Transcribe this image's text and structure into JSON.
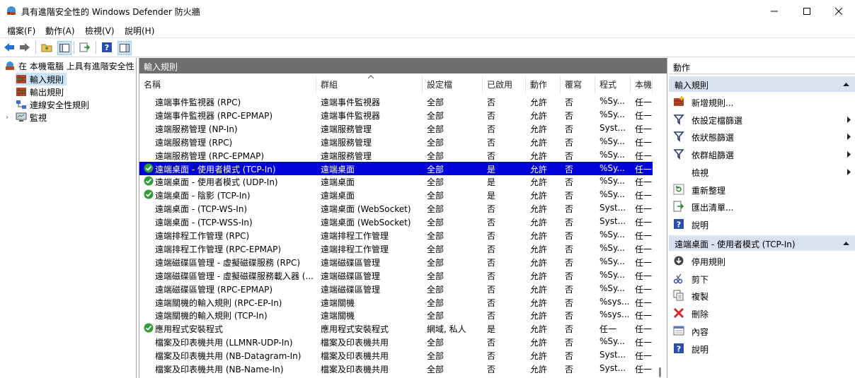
{
  "window": {
    "title": "具有進階安全性的 Windows Defender 防火牆"
  },
  "menu": [
    "檔案(F)",
    "動作(A)",
    "檢視(V)",
    "說明(H)"
  ],
  "tree": {
    "root": "在 本機電腦 上具有進階安全性",
    "items": [
      "輸入規則",
      "輸出規則",
      "連線安全性規則",
      "監視"
    ]
  },
  "center": {
    "title": "輸入規則",
    "columns": [
      "名稱",
      "群組",
      "設定檔",
      "已啟用",
      "動作",
      "覆寫",
      "程式",
      "本機..."
    ],
    "rows": [
      {
        "enabled_icon": false,
        "name": "遠端事件監視器 (RPC)",
        "group": "遠端事件監視器",
        "profile": "全部",
        "enabled": "否",
        "action": "允許",
        "override": "否",
        "program": "%Sy...",
        "local": "任一"
      },
      {
        "enabled_icon": false,
        "name": "遠端事件監視器 (RPC-EPMAP)",
        "group": "遠端事件監視器",
        "profile": "全部",
        "enabled": "否",
        "action": "允許",
        "override": "否",
        "program": "%Sy...",
        "local": "任一"
      },
      {
        "enabled_icon": false,
        "name": "遠端服務管理 (NP-In)",
        "group": "遠端服務管理",
        "profile": "全部",
        "enabled": "否",
        "action": "允許",
        "override": "否",
        "program": "Syst...",
        "local": "任一"
      },
      {
        "enabled_icon": false,
        "name": "遠端服務管理 (RPC)",
        "group": "遠端服務管理",
        "profile": "全部",
        "enabled": "否",
        "action": "允許",
        "override": "否",
        "program": "%Sy...",
        "local": "任一"
      },
      {
        "enabled_icon": false,
        "name": "遠端服務管理 (RPC-EPMAP)",
        "group": "遠端服務管理",
        "profile": "全部",
        "enabled": "否",
        "action": "允許",
        "override": "否",
        "program": "%Sy...",
        "local": "任一"
      },
      {
        "enabled_icon": true,
        "selected": true,
        "name": "遠端桌面 - 使用者模式 (TCP-In)",
        "group": "遠端桌面",
        "profile": "全部",
        "enabled": "是",
        "action": "允許",
        "override": "否",
        "program": "%Sy...",
        "local": "任一"
      },
      {
        "enabled_icon": true,
        "name": "遠端桌面 - 使用者模式 (UDP-In)",
        "group": "遠端桌面",
        "profile": "全部",
        "enabled": "是",
        "action": "允許",
        "override": "否",
        "program": "%Sy...",
        "local": "任一"
      },
      {
        "enabled_icon": true,
        "name": "遠端桌面 - 陰影 (TCP-In)",
        "group": "遠端桌面",
        "profile": "全部",
        "enabled": "是",
        "action": "允許",
        "override": "否",
        "program": "%Sy...",
        "local": "任一"
      },
      {
        "enabled_icon": false,
        "name": "遠端桌面 - (TCP-WS-In)",
        "group": "遠端桌面 (WebSocket)",
        "profile": "全部",
        "enabled": "否",
        "action": "允許",
        "override": "否",
        "program": "Syst...",
        "local": "任一"
      },
      {
        "enabled_icon": false,
        "name": "遠端桌面 - (TCP-WSS-In)",
        "group": "遠端桌面 (WebSocket)",
        "profile": "全部",
        "enabled": "否",
        "action": "允許",
        "override": "否",
        "program": "Syst...",
        "local": "任一"
      },
      {
        "enabled_icon": false,
        "name": "遠端排程工作管理 (RPC)",
        "group": "遠端排程工作管理",
        "profile": "全部",
        "enabled": "否",
        "action": "允許",
        "override": "否",
        "program": "%Sy...",
        "local": "任一"
      },
      {
        "enabled_icon": false,
        "name": "遠端排程工作管理 (RPC-EPMAP)",
        "group": "遠端排程工作管理",
        "profile": "全部",
        "enabled": "否",
        "action": "允許",
        "override": "否",
        "program": "%Sy...",
        "local": "任一"
      },
      {
        "enabled_icon": false,
        "name": "遠端磁碟區管理 - 虛擬磁碟服務 (RPC)",
        "group": "遠端磁碟區管理",
        "profile": "全部",
        "enabled": "否",
        "action": "允許",
        "override": "否",
        "program": "%Sy...",
        "local": "任一"
      },
      {
        "enabled_icon": false,
        "name": "遠端磁碟區管理 - 虛擬磁碟服務載入器 (...",
        "group": "遠端磁碟區管理",
        "profile": "全部",
        "enabled": "否",
        "action": "允許",
        "override": "否",
        "program": "%Sy...",
        "local": "任一"
      },
      {
        "enabled_icon": false,
        "name": "遠端磁碟區管理 (RPC-EPMAP)",
        "group": "遠端磁碟區管理",
        "profile": "全部",
        "enabled": "否",
        "action": "允許",
        "override": "否",
        "program": "%Sy...",
        "local": "任一"
      },
      {
        "enabled_icon": false,
        "name": "遠端關機的輸入規則 (RPC-EP-In)",
        "group": "遠端關機",
        "profile": "全部",
        "enabled": "否",
        "action": "允許",
        "override": "否",
        "program": "%sys...",
        "local": "任一"
      },
      {
        "enabled_icon": false,
        "name": "遠端關機的輸入規則 (TCP-In)",
        "group": "遠端關機",
        "profile": "全部",
        "enabled": "否",
        "action": "允許",
        "override": "否",
        "program": "%sys...",
        "local": "任一"
      },
      {
        "enabled_icon": true,
        "name": "應用程式安裝程式",
        "group": "應用程式安裝程式",
        "profile": "網域, 私人",
        "enabled": "是",
        "action": "允許",
        "override": "否",
        "program": "任一",
        "local": "任一"
      },
      {
        "enabled_icon": false,
        "name": "檔案及印表機共用 (LLMNR-UDP-In)",
        "group": "檔案及印表機共用",
        "profile": "全部",
        "enabled": "否",
        "action": "允許",
        "override": "否",
        "program": "%Sy...",
        "local": "任一"
      },
      {
        "enabled_icon": false,
        "name": "檔案及印表機共用 (NB-Datagram-In)",
        "group": "檔案及印表機共用",
        "profile": "全部",
        "enabled": "否",
        "action": "允許",
        "override": "否",
        "program": "Syst...",
        "local": "任一"
      },
      {
        "enabled_icon": false,
        "name": "檔案及印表機共用 (NB-Name-In)",
        "group": "檔案及印表機共用",
        "profile": "全部",
        "enabled": "否",
        "action": "允許",
        "override": "否",
        "program": "Syst...",
        "local": "任一"
      }
    ]
  },
  "actions": {
    "title": "動作",
    "section1": {
      "title": "輸入規則",
      "items": [
        {
          "icon": "new-rule-icon",
          "label": "新增規則...",
          "submenu": false
        },
        {
          "icon": "filter-icon",
          "label": "依設定檔篩選",
          "submenu": true
        },
        {
          "icon": "filter-icon",
          "label": "依狀態篩選",
          "submenu": true
        },
        {
          "icon": "filter-icon",
          "label": "依群組篩選",
          "submenu": true
        },
        {
          "icon": "",
          "label": "檢視",
          "submenu": true
        },
        {
          "icon": "refresh-icon",
          "label": "重新整理",
          "submenu": false
        },
        {
          "icon": "export-icon",
          "label": "匯出清單...",
          "submenu": false
        },
        {
          "icon": "help-icon",
          "label": "說明",
          "submenu": false
        }
      ]
    },
    "section2": {
      "title": "遠端桌面 - 使用者模式 (TCP-In)",
      "items": [
        {
          "icon": "disable-icon",
          "label": "停用規則"
        },
        {
          "icon": "cut-icon",
          "label": "剪下"
        },
        {
          "icon": "copy-icon",
          "label": "複製"
        },
        {
          "icon": "delete-icon",
          "label": "刪除"
        },
        {
          "icon": "properties-icon",
          "label": "內容"
        },
        {
          "icon": "help-icon",
          "label": "說明"
        }
      ]
    }
  },
  "colors": {
    "selection": "#0000d8",
    "header": "#6e6e6e",
    "action_header": "#d9e1ef"
  }
}
